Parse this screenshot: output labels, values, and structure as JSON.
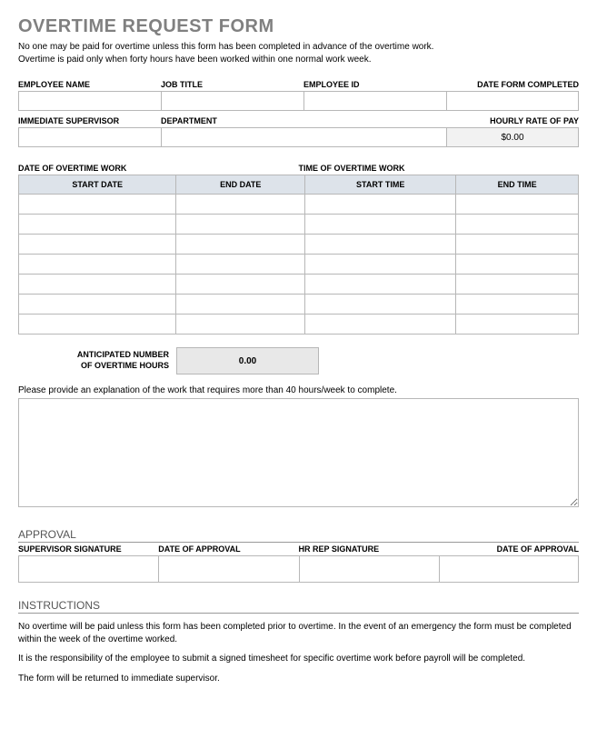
{
  "title": "OVERTIME REQUEST FORM",
  "intro_line1": "No one may be paid for overtime unless this form has been completed in advance of the overtime work.",
  "intro_line2": "Overtime is paid only when forty hours have been worked within one normal work week.",
  "fields": {
    "employee_name": "EMPLOYEE NAME",
    "job_title": "JOB TITLE",
    "employee_id": "EMPLOYEE ID",
    "date_form_completed": "DATE FORM COMPLETED",
    "immediate_supervisor": "IMMEDIATE SUPERVISOR",
    "department": "DEPARTMENT",
    "hourly_rate": "HOURLY RATE OF PAY",
    "hourly_rate_value": "$0.00"
  },
  "ot": {
    "date_header": "DATE OF OVERTIME WORK",
    "time_header": "TIME OF OVERTIME WORK",
    "cols": {
      "start_date": "START DATE",
      "end_date": "END DATE",
      "start_time": "START TIME",
      "end_time": "END TIME"
    }
  },
  "anticipated": {
    "label_line1": "ANTICIPATED NUMBER",
    "label_line2": "OF OVERTIME HOURS",
    "value": "0.00"
  },
  "explain_label": "Please provide an explanation of the work that requires more than 40 hours/week to complete.",
  "approval": {
    "title": "APPROVAL",
    "supervisor_sig": "SUPERVISOR SIGNATURE",
    "date1": "DATE OF APPROVAL",
    "hr_sig": "HR REP SIGNATURE",
    "date2": "DATE OF APPROVAL"
  },
  "instructions": {
    "title": "INSTRUCTIONS",
    "p1": "No overtime will be paid unless this form has been completed prior to overtime.  In the event of an emergency the form must be completed within the week of the overtime worked.",
    "p2": "It is the responsibility of the employee to submit a signed timesheet for specific overtime work before payroll will be completed.",
    "p3": "The form will be returned to immediate supervisor."
  }
}
